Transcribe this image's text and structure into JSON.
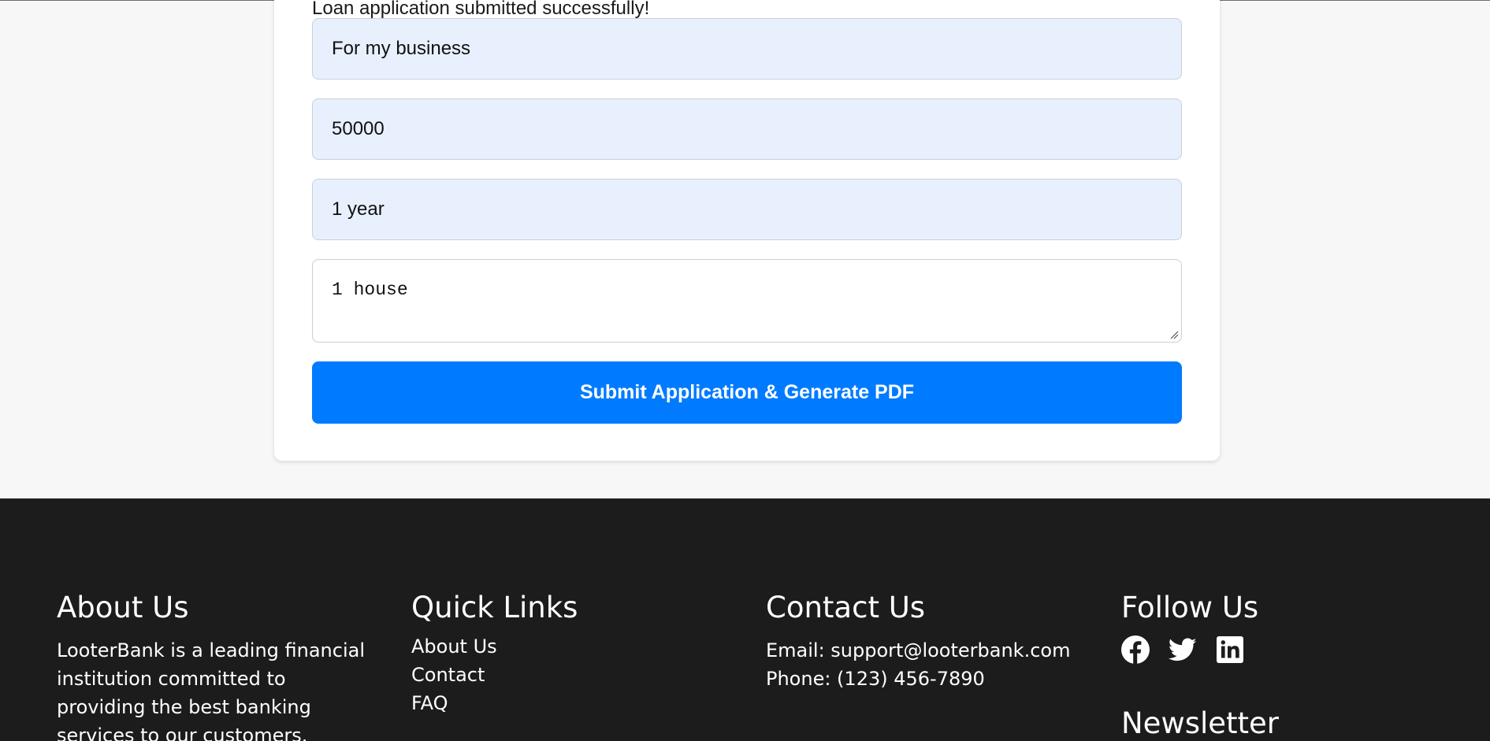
{
  "form": {
    "success_message": "Loan application submitted successfully!",
    "purpose_value": "For my business",
    "amount_value": "50000",
    "term_value": "1 year",
    "collateral_value": "1 house",
    "submit_label": "Submit Application & Generate PDF"
  },
  "footer": {
    "about": {
      "title": "About Us",
      "text": "LooterBank is a leading financial institution committed to providing the best banking services to our customers."
    },
    "quick_links": {
      "title": "Quick Links",
      "items": [
        "About Us",
        "Contact",
        "FAQ"
      ]
    },
    "contact": {
      "title": "Contact Us",
      "email": "Email: support@looterbank.com",
      "phone": "Phone: (123) 456-7890"
    },
    "follow": {
      "title": "Follow Us",
      "icons": [
        "facebook-icon",
        "twitter-icon",
        "linkedin-icon"
      ]
    },
    "newsletter": {
      "title": "Newsletter"
    }
  },
  "colors": {
    "accent": "#007bff",
    "autofill_bg": "#e8f0fe",
    "footer_bg": "#1c1c1c",
    "page_bg": "#f7f7f7"
  }
}
